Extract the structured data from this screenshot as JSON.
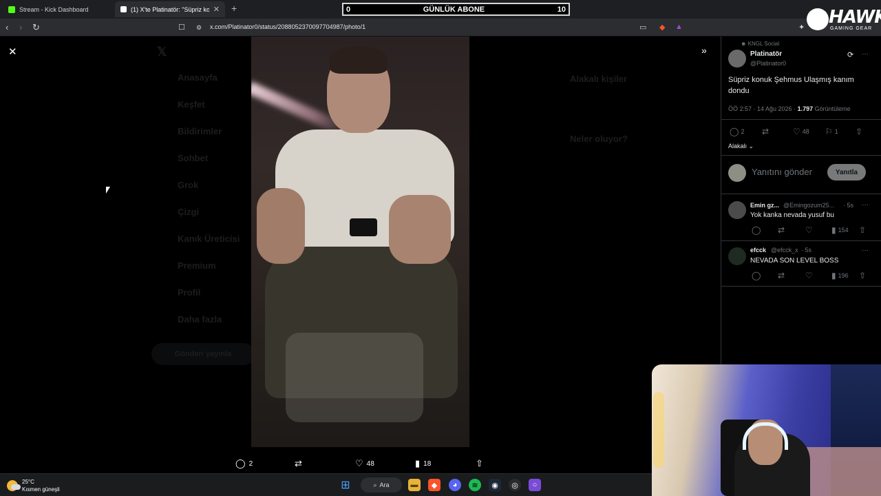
{
  "browser": {
    "tabs": [
      {
        "title": "Stream - Kick Dashboard",
        "favicon_color": "#53fc18"
      },
      {
        "title": "(1) X'te Platinatör: \"Süpriz konuk",
        "favicon_color": "#ffffff"
      }
    ],
    "url": "x.com/Platinator0/status/2088052370097704987/photo/1"
  },
  "overlay": {
    "subs_left": "0",
    "subs_title": "GÜNLÜK ABONE",
    "subs_right": "10",
    "brand": "HAWK",
    "brand_sub": "GAMING GEAR"
  },
  "background_nav": [
    "Anasayfa",
    "Keşfet",
    "Bildirimler",
    "Sohbet",
    "Grok",
    "Çizgi",
    "Kanık Üreticisi",
    "Premium",
    "Profil",
    "Daha fazla"
  ],
  "background_post_button": "Gönderi yayınla",
  "background_right": {
    "related": "Alakalı kişiler",
    "whats_happening": "Neler oluyor?"
  },
  "photo_actions": {
    "replies": "2",
    "reposts": "",
    "likes": "48",
    "views": "18"
  },
  "sidebar": {
    "context": "KNGL Social",
    "author_name": "Platinatör",
    "author_handle": "@Platinator0",
    "post_text": "Süpriz konuk Şehmus Ulaşmış kanım dondu",
    "post_time": "ÖÖ 2:57 · 14 Ağu 2026 · ",
    "post_views": "1.797",
    "post_views_label": " Görüntüleme",
    "stats": {
      "replies": "2",
      "reposts": "",
      "likes": "48",
      "bookmarks": "1"
    },
    "sort_label": "Alakalı",
    "reply_placeholder": "Yanıtını gönder",
    "reply_button": "Yanıtla",
    "replies": [
      {
        "name": "Emin gz...",
        "handle": "@Emingozum25...",
        "time": "· 5s",
        "text": "Yok kanka nevada yusuf bu",
        "views": "154"
      },
      {
        "name": "efcck",
        "handle": "@efcck_x",
        "time": "· 5s",
        "text": "NEVADA SON LEVEL BOSS",
        "views": "196"
      }
    ]
  },
  "taskbar": {
    "temperature": "25°C",
    "weather": "Kısmen güneşli",
    "search": "Ara"
  },
  "colors": {
    "accent": "#1d9bf0",
    "bg": "#000000",
    "muted": "#71767b"
  }
}
